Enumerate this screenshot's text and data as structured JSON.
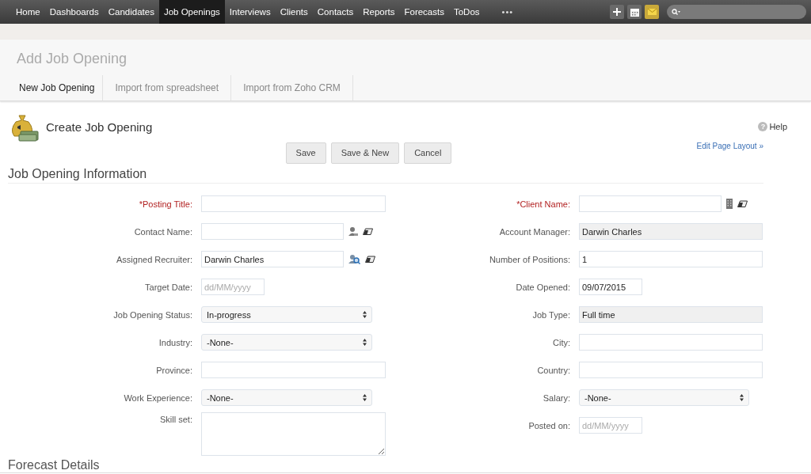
{
  "nav": {
    "items": [
      {
        "label": "Home",
        "selected": false
      },
      {
        "label": "Dashboards",
        "selected": false
      },
      {
        "label": "Candidates",
        "selected": false
      },
      {
        "label": "Job Openings",
        "selected": true
      },
      {
        "label": "Interviews",
        "selected": false
      },
      {
        "label": "Clients",
        "selected": false
      },
      {
        "label": "Contacts",
        "selected": false
      },
      {
        "label": "Reports",
        "selected": false
      },
      {
        "label": "Forecasts",
        "selected": false
      },
      {
        "label": "ToDos",
        "selected": false
      }
    ],
    "more": "•••"
  },
  "page_title": "Add Job Opening",
  "tabs": [
    {
      "label": "New Job Opening",
      "selected": true
    },
    {
      "label": "Import from spreadsheet",
      "selected": false
    },
    {
      "label": "Import from Zoho CRM",
      "selected": false
    }
  ],
  "form_title": "Create Job Opening",
  "help_icon": "?",
  "help": "Help",
  "buttons": [
    "Save",
    "Save & New",
    "Cancel"
  ],
  "edit_layout_link": "Edit Page Layout »",
  "section_title": "Job Opening Information",
  "rows": [
    {
      "fields": [
        {
          "label": "*Posting Title:",
          "required": true,
          "kind": "text"
        },
        {
          "label": "*Client Name:",
          "required": true,
          "kind": "client-lookup"
        }
      ]
    },
    {
      "fields": [
        {
          "label": "Contact Name:",
          "required": false,
          "kind": "contact-lookup"
        },
        {
          "label": "Account Manager:",
          "required": false,
          "kind": "readonly",
          "value": "Darwin Charles"
        }
      ]
    },
    {
      "fields": [
        {
          "label": "Assigned Recruiter:",
          "required": false,
          "kind": "user-lookup",
          "value": "Darwin Charles"
        },
        {
          "label": "Number of Positions:",
          "required": false,
          "kind": "text",
          "value": "1"
        }
      ]
    },
    {
      "fields": [
        {
          "label": "Target Date:",
          "required": false,
          "kind": "date",
          "placeholder": "dd/MM/yyyy"
        },
        {
          "label": "Date Opened:",
          "required": false,
          "kind": "date",
          "value": "09/07/2015"
        }
      ]
    },
    {
      "fields": [
        {
          "label": "Job Opening Status:",
          "required": false,
          "kind": "select",
          "value": "In-progress"
        },
        {
          "label": "Job Type:",
          "required": false,
          "kind": "readonly",
          "value": "Full time"
        }
      ]
    },
    {
      "fields": [
        {
          "label": "Industry:",
          "required": false,
          "kind": "select",
          "value": "-None-"
        },
        {
          "label": "City:",
          "required": false,
          "kind": "text"
        }
      ]
    },
    {
      "fields": [
        {
          "label": "Province:",
          "required": false,
          "kind": "text"
        },
        {
          "label": "Country:",
          "required": false,
          "kind": "text"
        }
      ]
    },
    {
      "fields": [
        {
          "label": "Work Experience:",
          "required": false,
          "kind": "select",
          "value": "-None-"
        },
        {
          "label": "Salary:",
          "required": false,
          "kind": "select-wide",
          "value": "-None-"
        }
      ]
    },
    {
      "fields": [
        {
          "label": "Skill set:",
          "required": false,
          "kind": "textarea"
        },
        {
          "label": "Posted on:",
          "required": false,
          "kind": "date",
          "placeholder": "dd/MM/yyyy"
        }
      ]
    }
  ],
  "next_section_title": "Forecast Details"
}
